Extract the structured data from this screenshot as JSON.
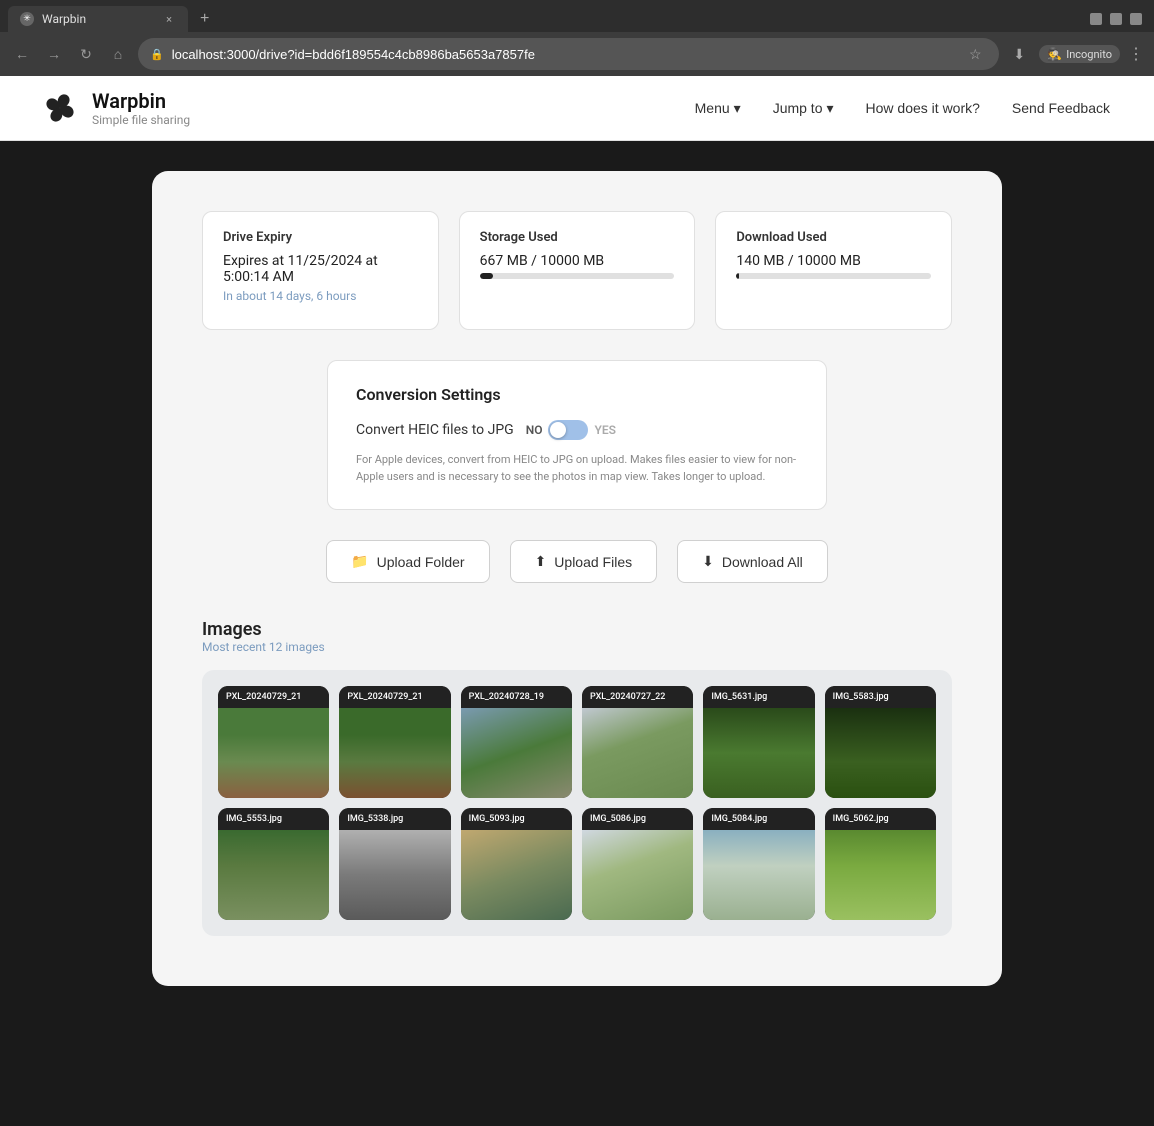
{
  "browser": {
    "tab_title": "Warpbin",
    "tab_favicon": "W",
    "url": "localhost:3000/drive?id=bdd6f189554c4cb8986ba5653a7857fe",
    "new_tab_label": "+",
    "back_label": "←",
    "forward_label": "→",
    "refresh_label": "↻",
    "home_label": "⌂",
    "star_label": "☆",
    "download_label": "⬇",
    "incognito_label": "Incognito",
    "menu_label": "⋮",
    "close_tab_label": "×"
  },
  "header": {
    "logo_icon": "✳",
    "app_name": "Warpbin",
    "app_subtitle": "Simple file sharing",
    "nav": [
      {
        "id": "menu",
        "label": "Menu",
        "has_dropdown": true
      },
      {
        "id": "jump_to",
        "label": "Jump to",
        "has_dropdown": true
      },
      {
        "id": "how_it_works",
        "label": "How does it work?",
        "has_dropdown": false
      },
      {
        "id": "send_feedback",
        "label": "Send Feedback",
        "has_dropdown": false
      }
    ]
  },
  "stats": [
    {
      "id": "drive_expiry",
      "title": "Drive Expiry",
      "value": "Expires at 11/25/2024 at 5:00:14 AM",
      "sub": "In about 14 days, 6 hours",
      "progress_pct": null
    },
    {
      "id": "storage_used",
      "title": "Storage Used",
      "value": "667 MB / 10000 MB",
      "sub": null,
      "progress_pct": 6.67
    },
    {
      "id": "download_used",
      "title": "Download Used",
      "value": "140 MB / 10000 MB",
      "sub": null,
      "progress_pct": 1.4
    }
  ],
  "conversion": {
    "title": "Conversion Settings",
    "label": "Convert HEIC files to JPG",
    "toggle_no": "NO",
    "toggle_yes": "YES",
    "description": "For Apple devices, convert from HEIC to JPG on upload. Makes files easier to view for non-Apple users and is necessary to see the photos in map view. Takes longer to upload."
  },
  "actions": [
    {
      "id": "upload_folder",
      "label": "Upload Folder",
      "icon": "folder-upload-icon"
    },
    {
      "id": "upload_files",
      "label": "Upload Files",
      "icon": "file-upload-icon"
    },
    {
      "id": "download_all",
      "label": "Download All",
      "icon": "download-cloud-icon"
    }
  ],
  "images_section": {
    "title": "Images",
    "subtitle": "Most recent 12 images",
    "images": [
      {
        "id": "img1",
        "label": "PXL_20240729_21",
        "color_class": "img-1"
      },
      {
        "id": "img2",
        "label": "PXL_20240729_21",
        "color_class": "img-2"
      },
      {
        "id": "img3",
        "label": "PXL_20240728_19",
        "color_class": "img-3"
      },
      {
        "id": "img4",
        "label": "PXL_20240727_22",
        "color_class": "img-4"
      },
      {
        "id": "img5",
        "label": "IMG_5631.jpg",
        "color_class": "img-5"
      },
      {
        "id": "img6",
        "label": "IMG_5583.jpg",
        "color_class": "img-6"
      },
      {
        "id": "img7",
        "label": "IMG_5553.jpg",
        "color_class": "img-7"
      },
      {
        "id": "img8",
        "label": "IMG_5338.jpg",
        "color_class": "img-8"
      },
      {
        "id": "img9",
        "label": "IMG_5093.jpg",
        "color_class": "img-9"
      },
      {
        "id": "img10",
        "label": "IMG_5086.jpg",
        "color_class": "img-10"
      },
      {
        "id": "img11",
        "label": "IMG_5084.jpg",
        "color_class": "img-11"
      },
      {
        "id": "img12",
        "label": "IMG_5062.jpg",
        "color_class": "img-12"
      }
    ]
  }
}
